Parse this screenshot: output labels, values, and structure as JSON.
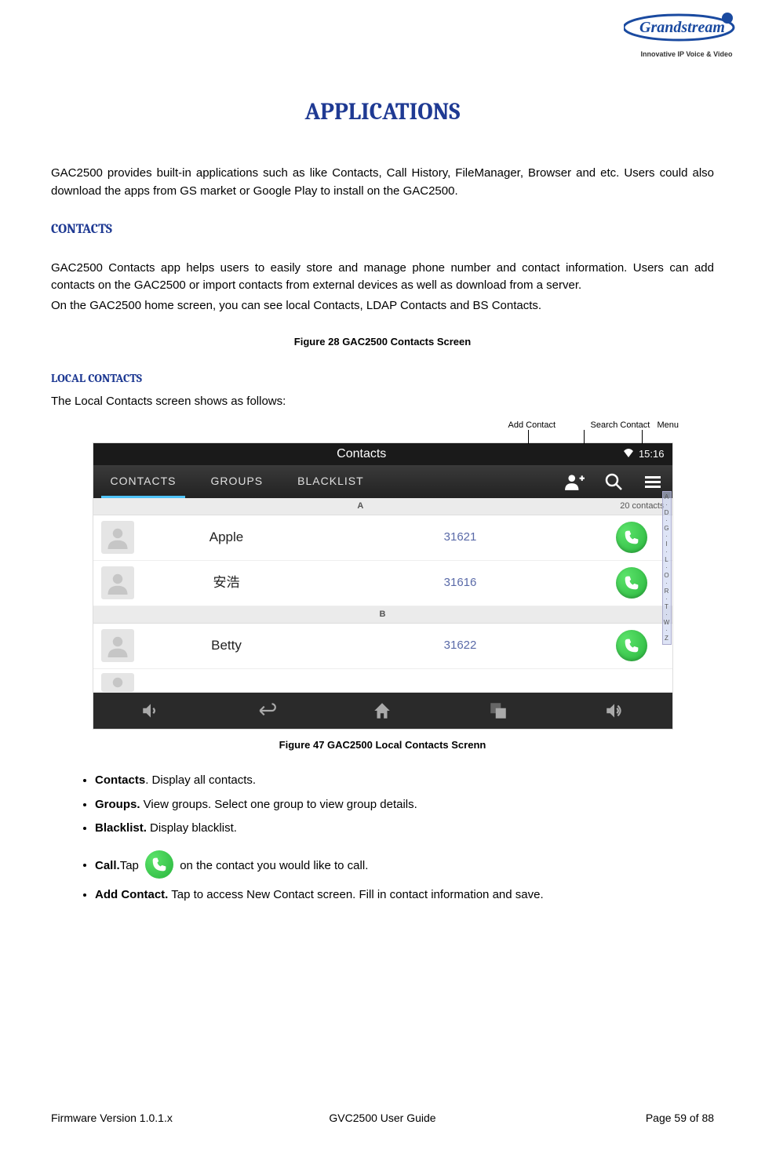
{
  "logo": {
    "tagline": "Innovative IP Voice & Video"
  },
  "title": "APPLICATIONS",
  "intro": "GAC2500 provides built-in applications such as like Contacts, Call History, FileManager, Browser and etc. Users could also download the apps from GS market or Google Play to install on the GAC2500.",
  "sec_contacts": {
    "heading": "CONTACTS",
    "p1": "GAC2500 Contacts app helps users to easily store and manage phone number and contact information. Users can add contacts on the GAC2500 or import contacts from external devices as well as download from a server.",
    "p2": "On the GAC2500 home screen, you can see local Contacts, LDAP Contacts and BS Contacts.",
    "fig1": "Figure 28 GAC2500 Contacts Screen"
  },
  "sec_local": {
    "heading": "LOCAL CONTACTS",
    "lead": "The Local Contacts screen shows as follows:",
    "fig2": "Figure 47 GAC2500 Local Contacts Screnn"
  },
  "annotations": {
    "add": "Add Contact",
    "search": "Search Contact",
    "menu": "Menu"
  },
  "screenshot": {
    "title": "Contacts",
    "time": "15:16",
    "tabs": {
      "contacts": "CONTACTS",
      "groups": "GROUPS",
      "blacklist": "BLACKLIST"
    },
    "section_a": "A",
    "count": "20 contacts",
    "rows": [
      {
        "name": "Apple",
        "num": "31621"
      },
      {
        "name": "安浩",
        "num": "31616"
      }
    ],
    "section_b": "B",
    "rows_b": [
      {
        "name": "Betty",
        "num": "31622"
      }
    ],
    "alpha": [
      "A",
      "·",
      "D",
      "·",
      "G",
      "·",
      "I",
      "·",
      "L",
      "·",
      "O",
      "·",
      "R",
      "·",
      "T",
      "·",
      "W",
      "·",
      "Z"
    ]
  },
  "bullets": {
    "contacts_b": "Contacts",
    "contacts_t": ". Display all contacts.",
    "groups_b": "Groups.",
    "groups_t": " View groups. Select one group to view group details.",
    "blacklist_b": "Blacklist.",
    "blacklist_t": " Display blacklist.",
    "call_b": "Call.",
    "call_t1": "Tap ",
    "call_t2": " on the contact you would like to call.",
    "add_b": "Add Contact.",
    "add_t": " Tap to access New Contact screen. Fill in contact information and save."
  },
  "footer": {
    "left": "Firmware Version 1.0.1.x",
    "center": "GVC2500 User Guide",
    "right": "Page 59 of 88"
  }
}
